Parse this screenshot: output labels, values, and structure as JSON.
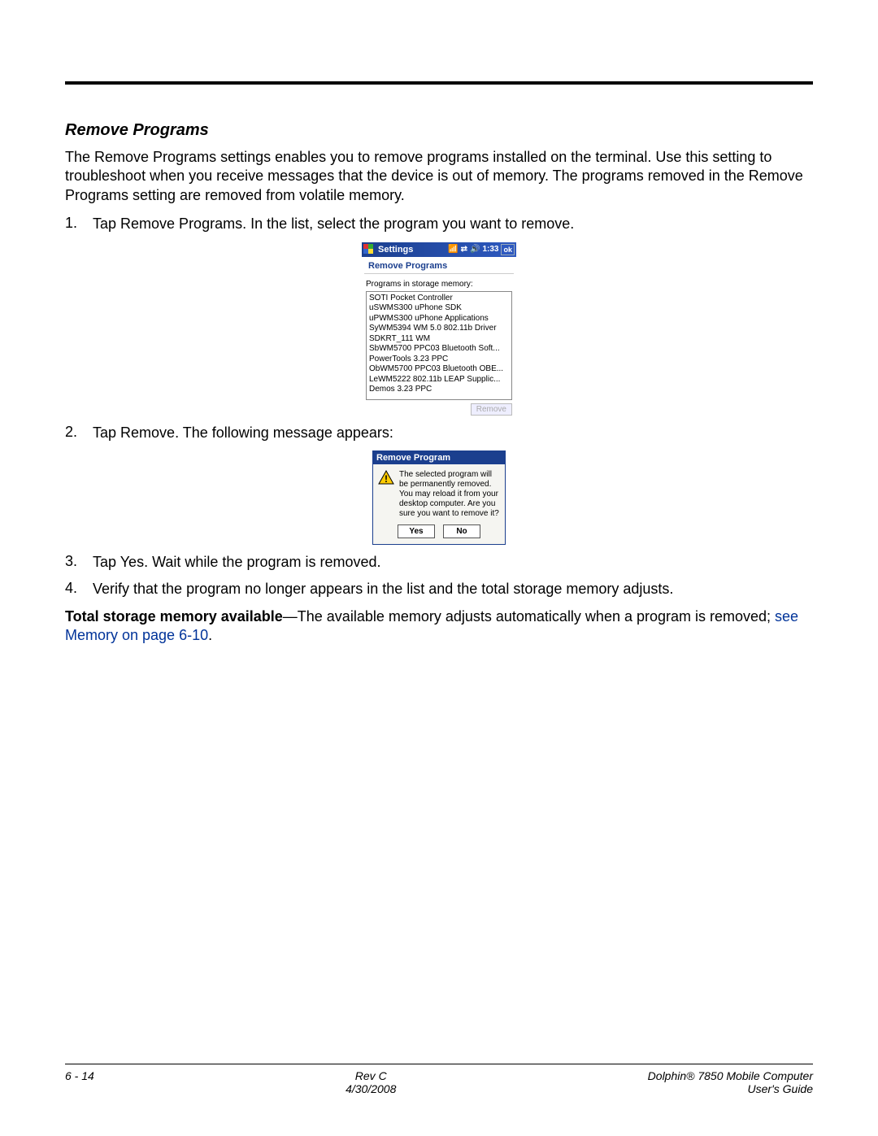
{
  "heading": "Remove Programs",
  "intro": "The Remove Programs settings enables you to remove programs installed on the terminal. Use this setting to troubleshoot when you receive messages that the device is out of memory. The programs removed in the Remove Programs setting are removed from volatile memory.",
  "step1_pre": "Tap ",
  "step1_bold": "Remove Programs",
  "step1_post": ". In the list, select the program you want to remove.",
  "step2_pre": "Tap ",
  "step2_bold": "Remove",
  "step2_post": ". The following message appears:",
  "step3_pre": "Tap ",
  "step3_bold": "Yes",
  "step3_post": ". Wait while the program is removed.",
  "step4": "Verify that the program no longer appears in the list and the total storage memory adjusts.",
  "final_bold": "Total storage memory available",
  "final_post": "—The available memory adjusts automatically when a program is removed; ",
  "final_link": "see Memory on page 6-10",
  "final_end": ".",
  "screenshot1": {
    "title": "Settings",
    "time": "1:33",
    "ok": "ok",
    "subhead": "Remove Programs",
    "label": "Programs in storage memory:",
    "items": [
      "SOTI Pocket Controller",
      "uSWMS300 uPhone SDK",
      "uPWMS300 uPhone Applications",
      "SyWM5394 WM 5.0 802.11b Driver",
      "SDKRT_111 WM",
      "SbWM5700 PPC03 Bluetooth Soft...",
      "PowerTools 3.23 PPC",
      "ObWM5700 PPC03 Bluetooth OBE...",
      "LeWM5222 802.11b LEAP Supplic...",
      "Demos 3.23 PPC"
    ],
    "remove_btn": "Remove"
  },
  "screenshot2": {
    "title": "Remove Program",
    "message": "The selected program will be permanently removed. You may reload it from your desktop computer. Are you sure you want to remove it?",
    "yes": "Yes",
    "no": "No"
  },
  "footer": {
    "page": "6 - 14",
    "rev": "Rev C",
    "date": "4/30/2008",
    "doc1": "Dolphin® 7850 Mobile Computer",
    "doc2": "User's Guide"
  }
}
